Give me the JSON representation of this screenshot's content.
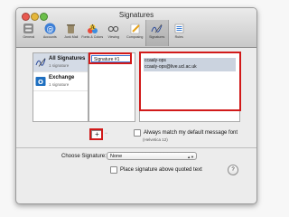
{
  "window": {
    "title": "Signatures"
  },
  "toolbar": {
    "items": [
      {
        "label": "General",
        "icon": "switch-icon"
      },
      {
        "label": "Accounts",
        "icon": "at-sign-icon"
      },
      {
        "label": "Junk Mail",
        "icon": "trash-icon"
      },
      {
        "label": "Fonts & Colors",
        "icon": "fonts-colors-icon"
      },
      {
        "label": "Viewing",
        "icon": "glasses-icon"
      },
      {
        "label": "Composing",
        "icon": "pencil-icon"
      },
      {
        "label": "Signatures",
        "icon": "signature-icon",
        "active": true
      },
      {
        "label": "Rules",
        "icon": "rules-icon"
      }
    ]
  },
  "accounts": {
    "items": [
      {
        "name": "All Signatures",
        "count": "1 signature",
        "selected": true
      },
      {
        "name": "Exchange",
        "count": "1 signature",
        "selected": false
      }
    ]
  },
  "signatures": {
    "items": [
      {
        "name": "Signature #1"
      }
    ]
  },
  "signature_content": {
    "line1": "ccaaly-ops",
    "line2": "ccaaly-ops@live.ucl.ac.uk"
  },
  "controls": {
    "add_label": "+",
    "remove_label": "−",
    "match_font_label": "Always match my default message font",
    "font_hint": "(Helvetica 12)",
    "choose_label": "Choose Signature:",
    "choose_value": "None",
    "place_above_label": "Place signature above quoted text",
    "help_label": "?"
  },
  "colors": {
    "highlight_red": "#d11a1a",
    "selection": "#d4dbe6",
    "text_selection": "#cbd3df"
  }
}
